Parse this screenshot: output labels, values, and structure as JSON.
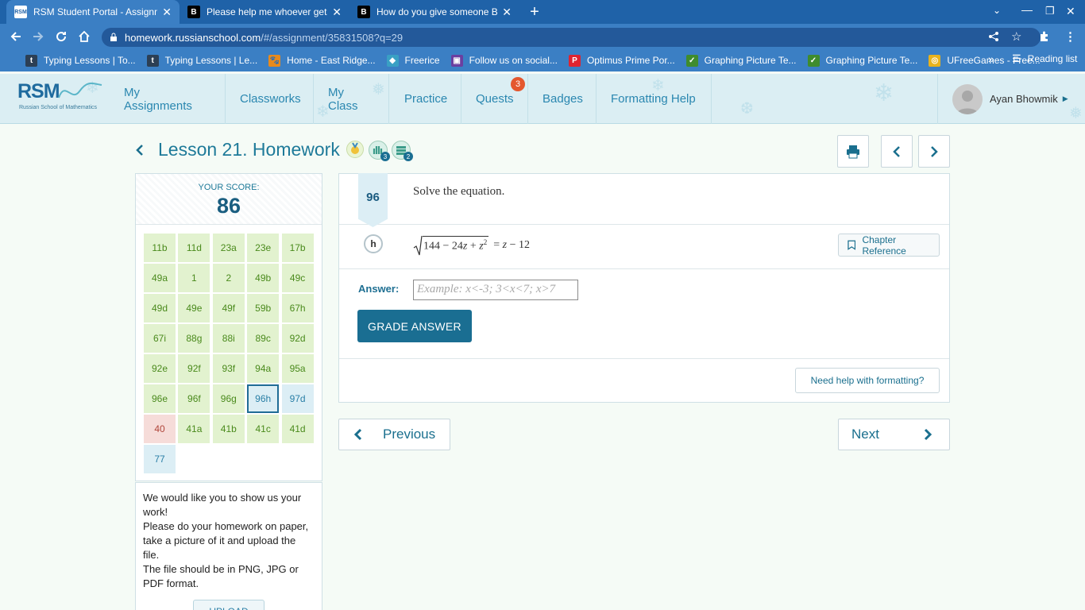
{
  "browser": {
    "tabs": [
      {
        "title": "RSM Student Portal - Assignments",
        "icon": "rsm-favicon"
      },
      {
        "title": "Please help me whoever gets the",
        "icon": "brainly-favicon"
      },
      {
        "title": "How do you give someone Brainliest",
        "icon": "brainly-favicon"
      }
    ],
    "tab_favicon_rsm": "RSM",
    "tab_favicon_brainly": "B",
    "url_host": "homework.russianschool.com",
    "url_rest": "/#/assignment/35831508?q=29",
    "bookmarks": [
      {
        "label": "Typing Lessons | To...",
        "icon": "tumblr-icon",
        "color": "#2c3f55"
      },
      {
        "label": "Typing Lessons | Le...",
        "icon": "tumblr-icon",
        "color": "#2c3f55"
      },
      {
        "label": "Home - East Ridge...",
        "icon": "paw-icon",
        "color": "#e88a1c"
      },
      {
        "label": "Freerice",
        "icon": "freerice-icon",
        "color": "#39a0c4"
      },
      {
        "label": "Follow us on social...",
        "icon": "social-icon",
        "color": "#6b3fa0"
      },
      {
        "label": "Optimus Prime Por...",
        "icon": "pinterest-icon",
        "color": "#e0232f"
      },
      {
        "label": "Graphing Picture Te...",
        "icon": "graph-icon",
        "color": "#3f8c2d"
      },
      {
        "label": "Graphing Picture Te...",
        "icon": "graph-icon",
        "color": "#3f8c2d"
      },
      {
        "label": "UFreeGames - Free...",
        "icon": "ufree-icon",
        "color": "#e8b21c"
      }
    ],
    "reading_list": "Reading list"
  },
  "app": {
    "logo_text": "RSM",
    "logo_subtitle": "Russian School of Mathematics",
    "nav": [
      {
        "label": "My Assignments"
      },
      {
        "label": "Classworks"
      },
      {
        "label": "My Class"
      },
      {
        "label": "Practice"
      },
      {
        "label": "Quests",
        "badge": "3"
      },
      {
        "label": "Badges"
      },
      {
        "label": "Formatting Help"
      }
    ],
    "user_name": "Ayan Bhowmik"
  },
  "lesson": {
    "title": "Lesson 21. Homework",
    "badge_counts": [
      "3",
      "2"
    ]
  },
  "score": {
    "label": "YOUR SCORE:",
    "value": "86",
    "grid": [
      [
        "11b",
        "11d",
        "23a",
        "23e",
        "17b"
      ],
      [
        "49a",
        "1",
        "2",
        "49b",
        "49c"
      ],
      [
        "49d",
        "49e",
        "49f",
        "59b",
        "67h"
      ],
      [
        "67i",
        "88g",
        "88i",
        "89c",
        "92d"
      ],
      [
        "92e",
        "92f",
        "93f",
        "94a",
        "95a"
      ],
      [
        "96e",
        "96f",
        "96g",
        "96h",
        "97d"
      ],
      [
        "40",
        "41a",
        "41b",
        "41c",
        "41d"
      ],
      [
        "77"
      ]
    ],
    "current": "96h",
    "blue_items": [
      "97d",
      "77"
    ],
    "red_items": [
      "40"
    ]
  },
  "work": {
    "line1": "We would like you to show us your work!",
    "line2": "Please do your homework on paper, take a picture of it and upload the file.",
    "line3": "The file should be in PNG, JPG or PDF format.",
    "upload": "UPLOAD"
  },
  "problem": {
    "number": "96",
    "prompt": "Solve the equation.",
    "part": "h",
    "chapter_reference": "Chapter Reference",
    "answer_label": "Answer:",
    "answer_placeholder": "Example: x<-3; 3<x<7; x>7",
    "grade_button": "GRADE ANSWER",
    "formatting_help": "Need help with formatting?"
  },
  "pager": {
    "previous": "Previous",
    "next": "Next"
  },
  "colors": {
    "accent": "#1a6e92",
    "green_cell": "#e2f2cf",
    "browser": "#1f62a8"
  }
}
